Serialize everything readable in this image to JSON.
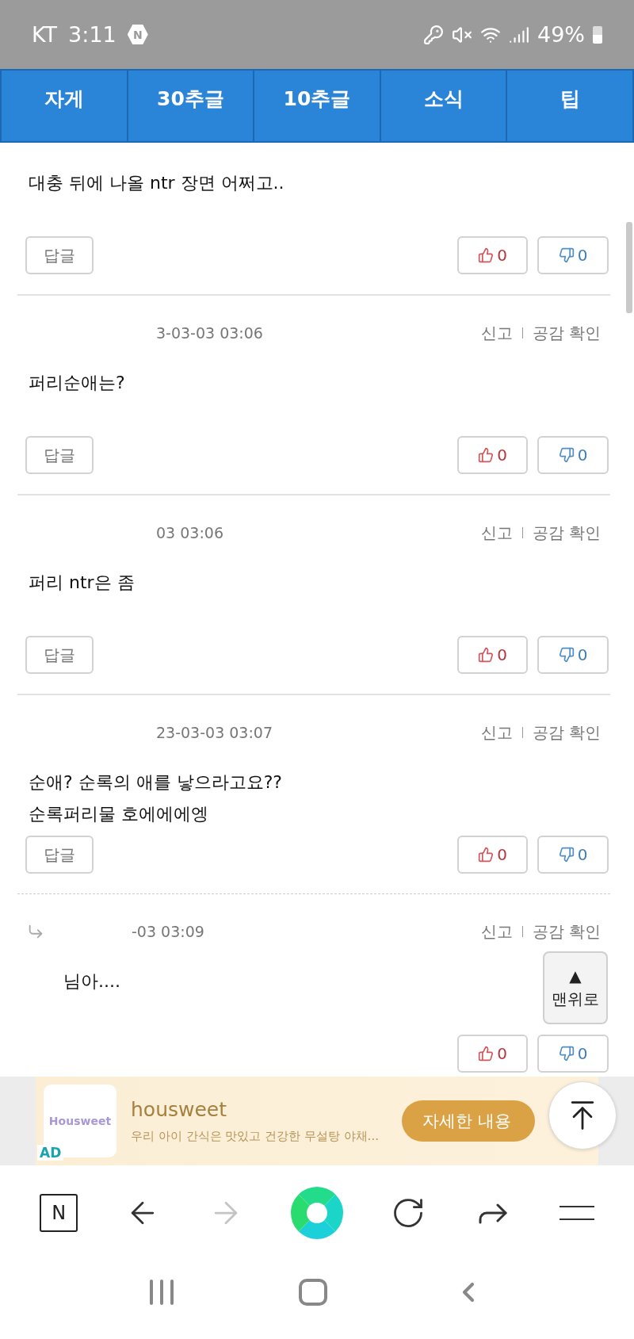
{
  "status_bar": {
    "carrier": "KT",
    "time": "3:11",
    "app_badge": "N",
    "battery": "49%"
  },
  "tabs": [
    {
      "label": "자게",
      "selected": false
    },
    {
      "label": "30추글",
      "selected": false
    },
    {
      "label": "10추글",
      "selected": false
    },
    {
      "label": "소식",
      "selected": false
    },
    {
      "label": "팁",
      "selected": false
    }
  ],
  "comments": [
    {
      "kind": "partial",
      "lines": [
        "대충 뒤에 나올 ntr 장면 어쩌고.."
      ],
      "reply_label": "답글",
      "likes": "0",
      "dislikes": "0"
    },
    {
      "kind": "comment",
      "date": "3-03-03 03:06",
      "report": "신고",
      "empathy": "공감 확인",
      "lines": [
        "퍼리순애는?"
      ],
      "reply_label": "답글",
      "likes": "0",
      "dislikes": "0"
    },
    {
      "kind": "comment",
      "date": "03 03:06",
      "report": "신고",
      "empathy": "공감 확인",
      "lines": [
        "퍼리 ntr은 좀"
      ],
      "reply_label": "답글",
      "likes": "0",
      "dislikes": "0"
    },
    {
      "kind": "comment",
      "date": "23-03-03 03:07",
      "report": "신고",
      "empathy": "공감 확인",
      "lines": [
        "순애?  순록의 애를 낳으라고요??",
        "순록퍼리물 호에에에엥"
      ],
      "reply_label": "답글",
      "likes": "0",
      "dislikes": "0"
    },
    {
      "kind": "reply",
      "date": "-03 03:09",
      "report": "신고",
      "empathy": "공감 확인",
      "lines": [
        "님아...."
      ],
      "likes": "0",
      "dislikes": "0"
    }
  ],
  "to_top": {
    "arrow": "▲",
    "label": "맨위로"
  },
  "ad": {
    "logo_text": "Housweet",
    "badge": "AD",
    "title": "housweet",
    "description": "우리 아이 간식은 맛있고 건강한 무설탕 야채...",
    "button": "자세한 내용"
  },
  "browser_nav": {
    "home_badge": "N",
    "forward_disabled": true
  }
}
